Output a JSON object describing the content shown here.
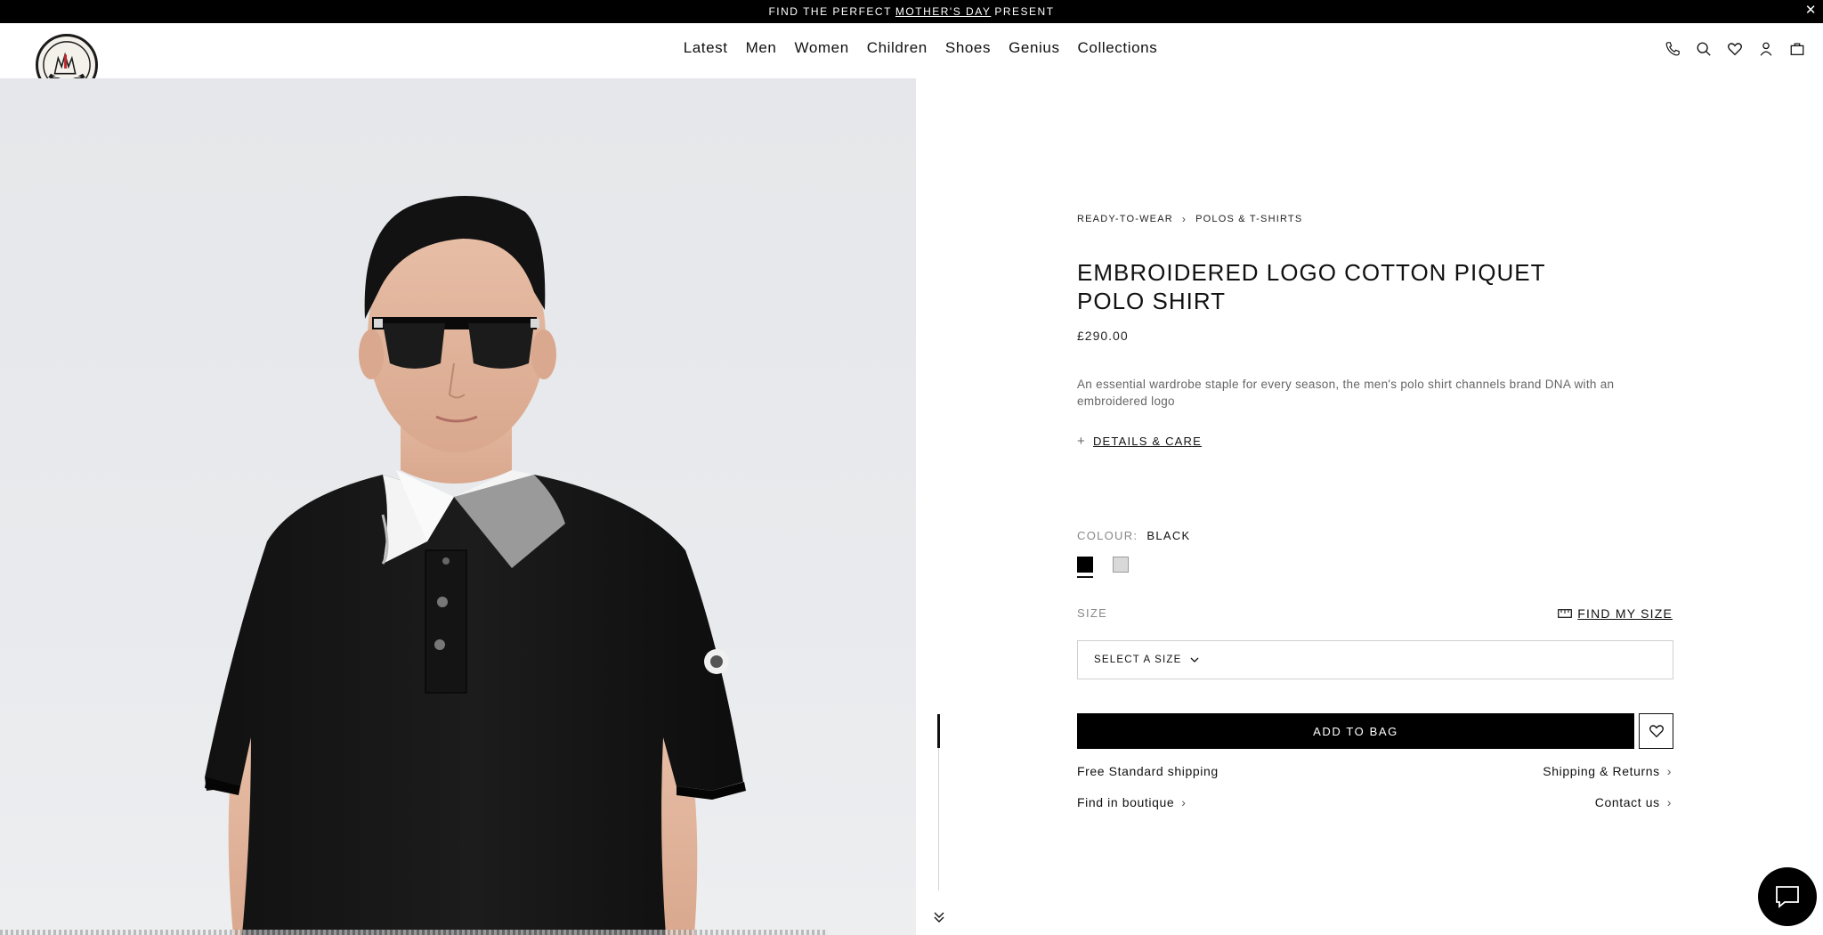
{
  "promo": {
    "prefix": "FIND THE PERFECT",
    "link": "MOTHER'S DAY",
    "suffix": "PRESENT",
    "close_icon": "close-icon"
  },
  "header": {
    "logo_text": "MONCLER",
    "nav": [
      "Latest",
      "Men",
      "Women",
      "Children",
      "Shoes",
      "Genius",
      "Collections"
    ],
    "icons": [
      "phone-icon",
      "search-icon",
      "heart-icon",
      "user-icon",
      "bag-icon"
    ]
  },
  "product": {
    "breadcrumb": [
      "READY-TO-WEAR",
      "POLOS & T-SHIRTS"
    ],
    "title": "EMBROIDERED LOGO COTTON PIQUET POLO SHIRT",
    "price": "£290.00",
    "description": "An essential wardrobe staple for every season, the men's polo shirt channels brand DNA with an embroidered logo",
    "details_label": "DETAILS & CARE",
    "colour_label": "COLOUR:",
    "colour_value": "BLACK",
    "swatches": [
      {
        "name": "Black",
        "color": "#000000",
        "selected": true
      },
      {
        "name": "Grey",
        "color": "#d9d9d9",
        "selected": false
      }
    ],
    "size_label": "SIZE",
    "find_size_label": "FIND MY SIZE",
    "size_select_label": "SELECT A SIZE",
    "add_to_bag_label": "ADD TO BAG"
  },
  "services": {
    "shipping_free": "Free Standard shipping",
    "shipping_returns": "Shipping & Returns",
    "find_boutique": "Find in boutique",
    "contact": "Contact us"
  },
  "colors": {
    "promo_bar": "#000000",
    "accent": "#000000",
    "image_bg": "#e6e8eb",
    "text_muted": "#888888"
  }
}
